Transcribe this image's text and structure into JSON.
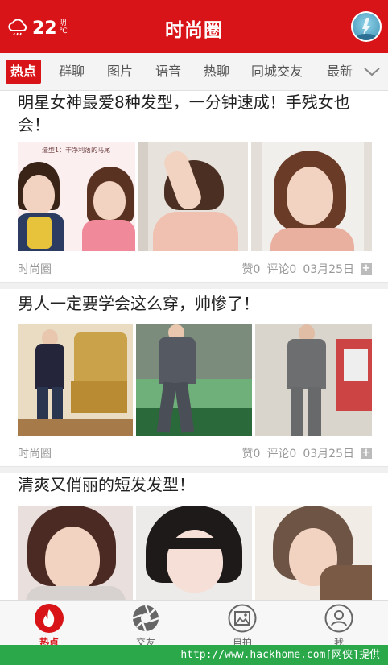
{
  "header": {
    "temperature": "22",
    "unit_top": "阴",
    "unit_bottom": "℃",
    "title": "时尚圈",
    "weather_icon": "cloud-rain-icon",
    "avatar_icon": "user-avatar"
  },
  "tabs": {
    "items": [
      {
        "label": "热点",
        "active": true
      },
      {
        "label": "群聊"
      },
      {
        "label": "图片"
      },
      {
        "label": "语音"
      },
      {
        "label": "热聊"
      },
      {
        "label": "同城交友"
      },
      {
        "label": "最新"
      }
    ],
    "more_icon": "chevron-down-icon"
  },
  "articles": [
    {
      "title": "明星女神最爱8种发型，一分钟速成！手残女也会！",
      "image_caption": "造型1：干净利落的马尾",
      "source": "时尚圈",
      "likes": "赞0",
      "comments": "评论0",
      "date": "03月25日"
    },
    {
      "title": "男人一定要学会这么穿，帅惨了！",
      "source": "时尚圈",
      "likes": "赞0",
      "comments": "评论0",
      "date": "03月25日"
    },
    {
      "title": "清爽又俏丽的短发发型！"
    }
  ],
  "bottom_nav": [
    {
      "label": "热点",
      "icon": "flame-icon",
      "active": true
    },
    {
      "label": "交友",
      "icon": "aperture-icon"
    },
    {
      "label": "自拍",
      "icon": "picture-icon"
    },
    {
      "label": "我",
      "icon": "profile-icon"
    }
  ],
  "watermark": "http://www.hackhome.com[网侠]提供",
  "colors": {
    "accent": "#d81418",
    "watermark_bg": "#2aa84a"
  }
}
